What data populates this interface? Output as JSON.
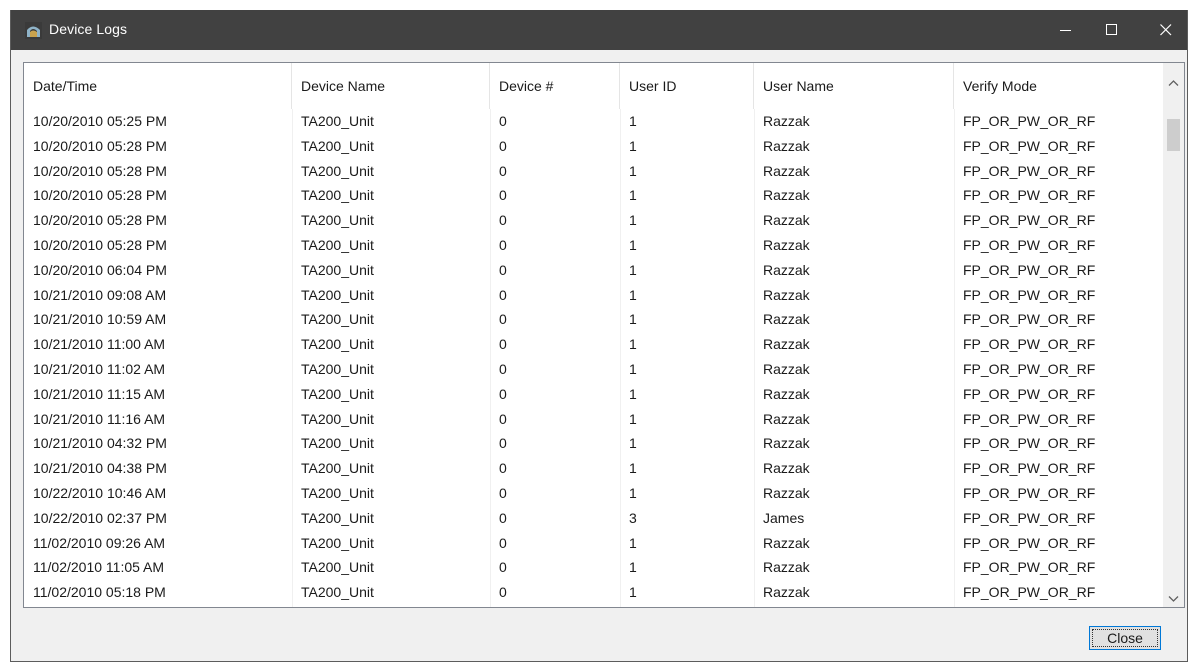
{
  "window": {
    "title": "Device Logs",
    "icon": "app-icon"
  },
  "columns": [
    "Date/Time",
    "Device Name",
    "Device #",
    "User ID",
    "User Name",
    "Verify Mode"
  ],
  "rows": [
    [
      "10/20/2010 05:25 PM",
      "TA200_Unit",
      "0",
      "1",
      "Razzak",
      "FP_OR_PW_OR_RF"
    ],
    [
      "10/20/2010 05:28 PM",
      "TA200_Unit",
      "0",
      "1",
      "Razzak",
      "FP_OR_PW_OR_RF"
    ],
    [
      "10/20/2010 05:28 PM",
      "TA200_Unit",
      "0",
      "1",
      "Razzak",
      "FP_OR_PW_OR_RF"
    ],
    [
      "10/20/2010 05:28 PM",
      "TA200_Unit",
      "0",
      "1",
      "Razzak",
      "FP_OR_PW_OR_RF"
    ],
    [
      "10/20/2010 05:28 PM",
      "TA200_Unit",
      "0",
      "1",
      "Razzak",
      "FP_OR_PW_OR_RF"
    ],
    [
      "10/20/2010 05:28 PM",
      "TA200_Unit",
      "0",
      "1",
      "Razzak",
      "FP_OR_PW_OR_RF"
    ],
    [
      "10/20/2010 06:04 PM",
      "TA200_Unit",
      "0",
      "1",
      "Razzak",
      "FP_OR_PW_OR_RF"
    ],
    [
      "10/21/2010 09:08 AM",
      "TA200_Unit",
      "0",
      "1",
      "Razzak",
      "FP_OR_PW_OR_RF"
    ],
    [
      "10/21/2010 10:59 AM",
      "TA200_Unit",
      "0",
      "1",
      "Razzak",
      "FP_OR_PW_OR_RF"
    ],
    [
      "10/21/2010 11:00 AM",
      "TA200_Unit",
      "0",
      "1",
      "Razzak",
      "FP_OR_PW_OR_RF"
    ],
    [
      "10/21/2010 11:02 AM",
      "TA200_Unit",
      "0",
      "1",
      "Razzak",
      "FP_OR_PW_OR_RF"
    ],
    [
      "10/21/2010 11:15 AM",
      "TA200_Unit",
      "0",
      "1",
      "Razzak",
      "FP_OR_PW_OR_RF"
    ],
    [
      "10/21/2010 11:16 AM",
      "TA200_Unit",
      "0",
      "1",
      "Razzak",
      "FP_OR_PW_OR_RF"
    ],
    [
      "10/21/2010 04:32 PM",
      "TA200_Unit",
      "0",
      "1",
      "Razzak",
      "FP_OR_PW_OR_RF"
    ],
    [
      "10/21/2010 04:38 PM",
      "TA200_Unit",
      "0",
      "1",
      "Razzak",
      "FP_OR_PW_OR_RF"
    ],
    [
      "10/22/2010 10:46 AM",
      "TA200_Unit",
      "0",
      "1",
      "Razzak",
      "FP_OR_PW_OR_RF"
    ],
    [
      "10/22/2010 02:37 PM",
      "TA200_Unit",
      "0",
      "3",
      "James",
      "FP_OR_PW_OR_RF"
    ],
    [
      "11/02/2010 09:26 AM",
      "TA200_Unit",
      "0",
      "1",
      "Razzak",
      "FP_OR_PW_OR_RF"
    ],
    [
      "11/02/2010 11:05 AM",
      "TA200_Unit",
      "0",
      "1",
      "Razzak",
      "FP_OR_PW_OR_RF"
    ],
    [
      "11/02/2010 05:18 PM",
      "TA200_Unit",
      "0",
      "1",
      "Razzak",
      "FP_OR_PW_OR_RF"
    ]
  ],
  "buttons": {
    "close_label": "Close"
  },
  "colors": {
    "titlebar": "#414141",
    "focus_border": "#0078d7"
  }
}
